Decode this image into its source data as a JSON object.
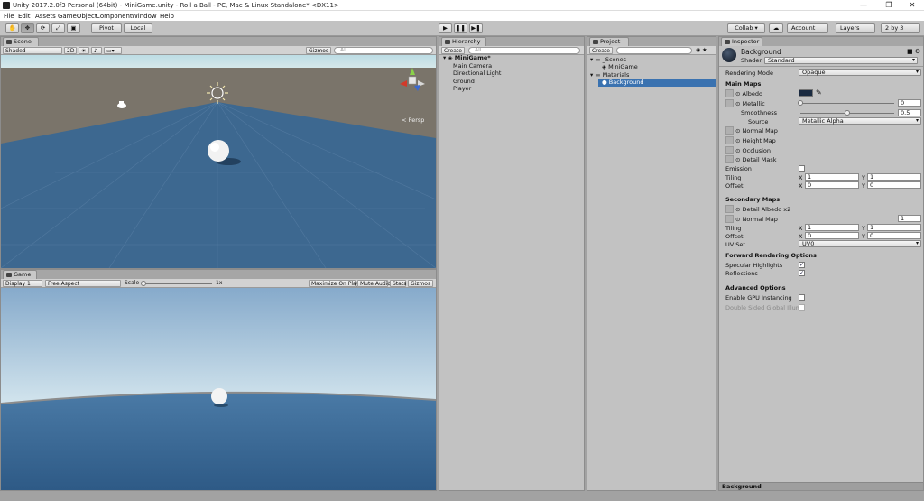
{
  "window": {
    "title": "Unity 2017.2.0f3 Personal (64bit) - MiniGame.unity - Roll a Ball - PC, Mac & Linux Standalone* <DX11>",
    "minimize": "—",
    "maximize": "❐",
    "close": "✕"
  },
  "menu": [
    "File",
    "Edit",
    "Assets",
    "GameObject",
    "Component",
    "Window",
    "Help"
  ],
  "toolbar": {
    "hand": "✋",
    "move": "✥",
    "rotate": "⟳",
    "scale": "⤢",
    "rect": "▣",
    "pivot": "Pivot",
    "local": "Local",
    "play": "▶",
    "pause": "❚❚",
    "step": "▶❚",
    "collab": "Collab ▾",
    "cloud": "☁",
    "account": "Account",
    "layers": "Layers",
    "layout": "2 by 3"
  },
  "scene": {
    "tab": "Scene",
    "shading": "Shaded",
    "mode2d": "2D",
    "gizmos": "Gizmos",
    "search": "All",
    "persp": "< Persp"
  },
  "game": {
    "tab": "Game",
    "display": "Display 1",
    "aspect": "Free Aspect",
    "scale_label": "Scale",
    "scale_value": "1x",
    "maximize": "Maximize On Play",
    "mute": "Mute Audio",
    "stats": "Stats",
    "gizmos": "Gizmos"
  },
  "hierarchy": {
    "tab": "Hierarchy",
    "create": "Create",
    "search": "All",
    "scene": "MiniGame*",
    "items": [
      "Main Camera",
      "Directional Light",
      "Ground",
      "Player"
    ]
  },
  "project": {
    "tab": "Project",
    "create": "Create",
    "items": [
      "_Scenes",
      "MiniGame",
      "Materials",
      "Background"
    ]
  },
  "inspector": {
    "tab": "Inspector",
    "name": "Background",
    "shader_label": "Shader",
    "shader": "Standard",
    "rendering_mode_label": "Rendering Mode",
    "rendering_mode": "Opaque",
    "main_maps": "Main Maps",
    "albedo": "Albedo",
    "albedo_color": "#1a2a40",
    "metallic": "Metallic",
    "metallic_value": "0",
    "metallic_fraction": 0,
    "smoothness": "Smoothness",
    "smoothness_value": "0.5",
    "smoothness_fraction": 0.5,
    "source": "Source",
    "source_value": "Metallic Alpha",
    "normal_map": "Normal Map",
    "height_map": "Height Map",
    "occlusion": "Occlusion",
    "detail_mask": "Detail Mask",
    "emission": "Emission",
    "tiling": "Tiling",
    "offset": "Offset",
    "x": "X",
    "y": "Y",
    "tiling_x": "1",
    "tiling_y": "1",
    "offset_x": "0",
    "offset_y": "0",
    "secondary_maps": "Secondary Maps",
    "detail_albedo": "Detail Albedo x2",
    "sec_normal_map": "Normal Map",
    "sec_normal_value": "1",
    "sec_tiling_x": "1",
    "sec_tiling_y": "1",
    "sec_offset_x": "0",
    "sec_offset_y": "0",
    "uv_set": "UV Set",
    "uv_set_value": "UV0",
    "forward_rendering": "Forward Rendering Options",
    "specular_highlights": "Specular Highlights",
    "reflections": "Reflections",
    "advanced": "Advanced Options",
    "gpu_instancing": "Enable GPU Instancing",
    "double_sided": "Double Sided Global Illum",
    "footer": "Background"
  },
  "colors": {
    "sky": "#bcdce4",
    "ground": "#3d6890",
    "horizon": "#7a746a"
  }
}
